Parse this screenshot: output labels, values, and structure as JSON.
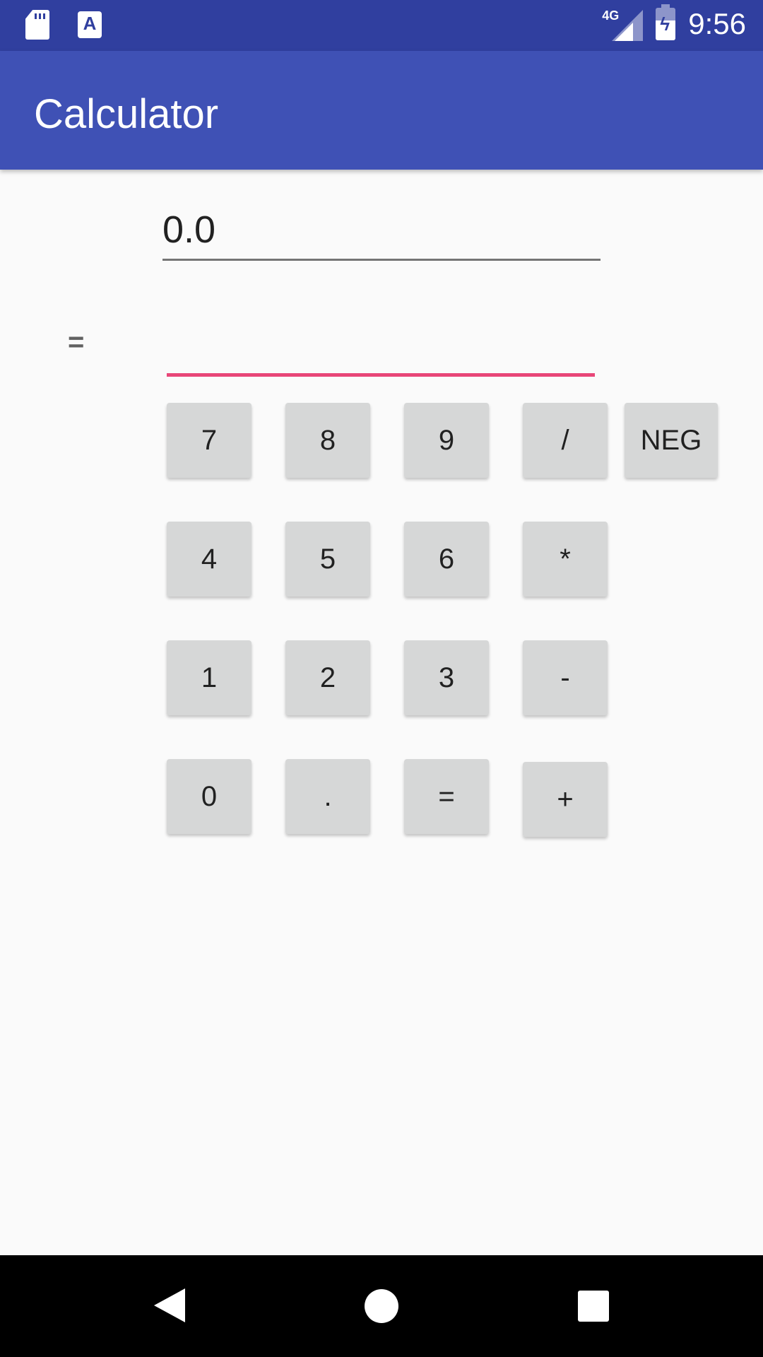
{
  "status_bar": {
    "network": "4G",
    "time": "9:56",
    "icons": [
      "sd-card-icon",
      "text-a-icon",
      "signal-icon",
      "battery-charging-icon"
    ]
  },
  "app_bar": {
    "title": "Calculator"
  },
  "result": {
    "value": "0.0"
  },
  "operation": {
    "symbol": "=",
    "input_value": ""
  },
  "keypad": {
    "btn_7": "7",
    "btn_8": "8",
    "btn_9": "9",
    "btn_div": "/",
    "btn_neg": "NEG",
    "btn_4": "4",
    "btn_5": "5",
    "btn_6": "6",
    "btn_mul": "*",
    "btn_1": "1",
    "btn_2": "2",
    "btn_3": "3",
    "btn_sub": "-",
    "btn_0": "0",
    "btn_dot": ".",
    "btn_eq": "=",
    "btn_add": "+"
  },
  "colors": {
    "status_bar": "#303f9f",
    "app_bar": "#3f51b5",
    "accent": "#e84678",
    "button": "#d6d7d7"
  }
}
